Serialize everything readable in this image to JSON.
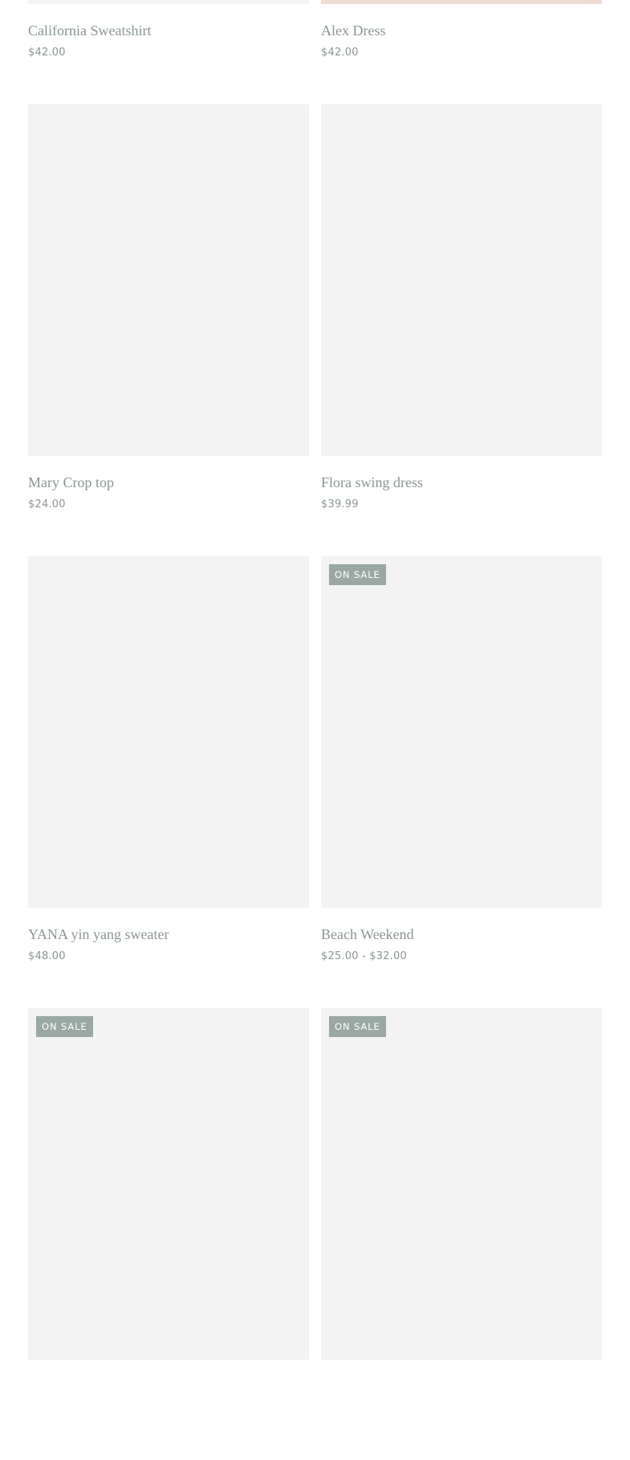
{
  "colors": {
    "placeholder_bg": "#f3f3f3",
    "badge_bg": "#9aa8a3",
    "text": "#8a9692"
  },
  "products": [
    {
      "title": "California Sweatshirt",
      "price": "$42.00",
      "on_sale": false
    },
    {
      "title": "Alex Dress",
      "price": "$42.00",
      "on_sale": false
    },
    {
      "title": "Mary Crop top",
      "price": "$24.00",
      "on_sale": false
    },
    {
      "title": "Flora swing dress",
      "price": "$39.99",
      "on_sale": false
    },
    {
      "title": "YANA yin yang sweater",
      "price": "$48.00",
      "on_sale": false
    },
    {
      "title": "Beach Weekend",
      "price": "$25.00 - $32.00",
      "on_sale": true,
      "badge": "ON SALE"
    },
    {
      "title": "",
      "price": "",
      "on_sale": true,
      "badge": "ON SALE"
    },
    {
      "title": "",
      "price": "",
      "on_sale": true,
      "badge": "ON SALE"
    }
  ]
}
